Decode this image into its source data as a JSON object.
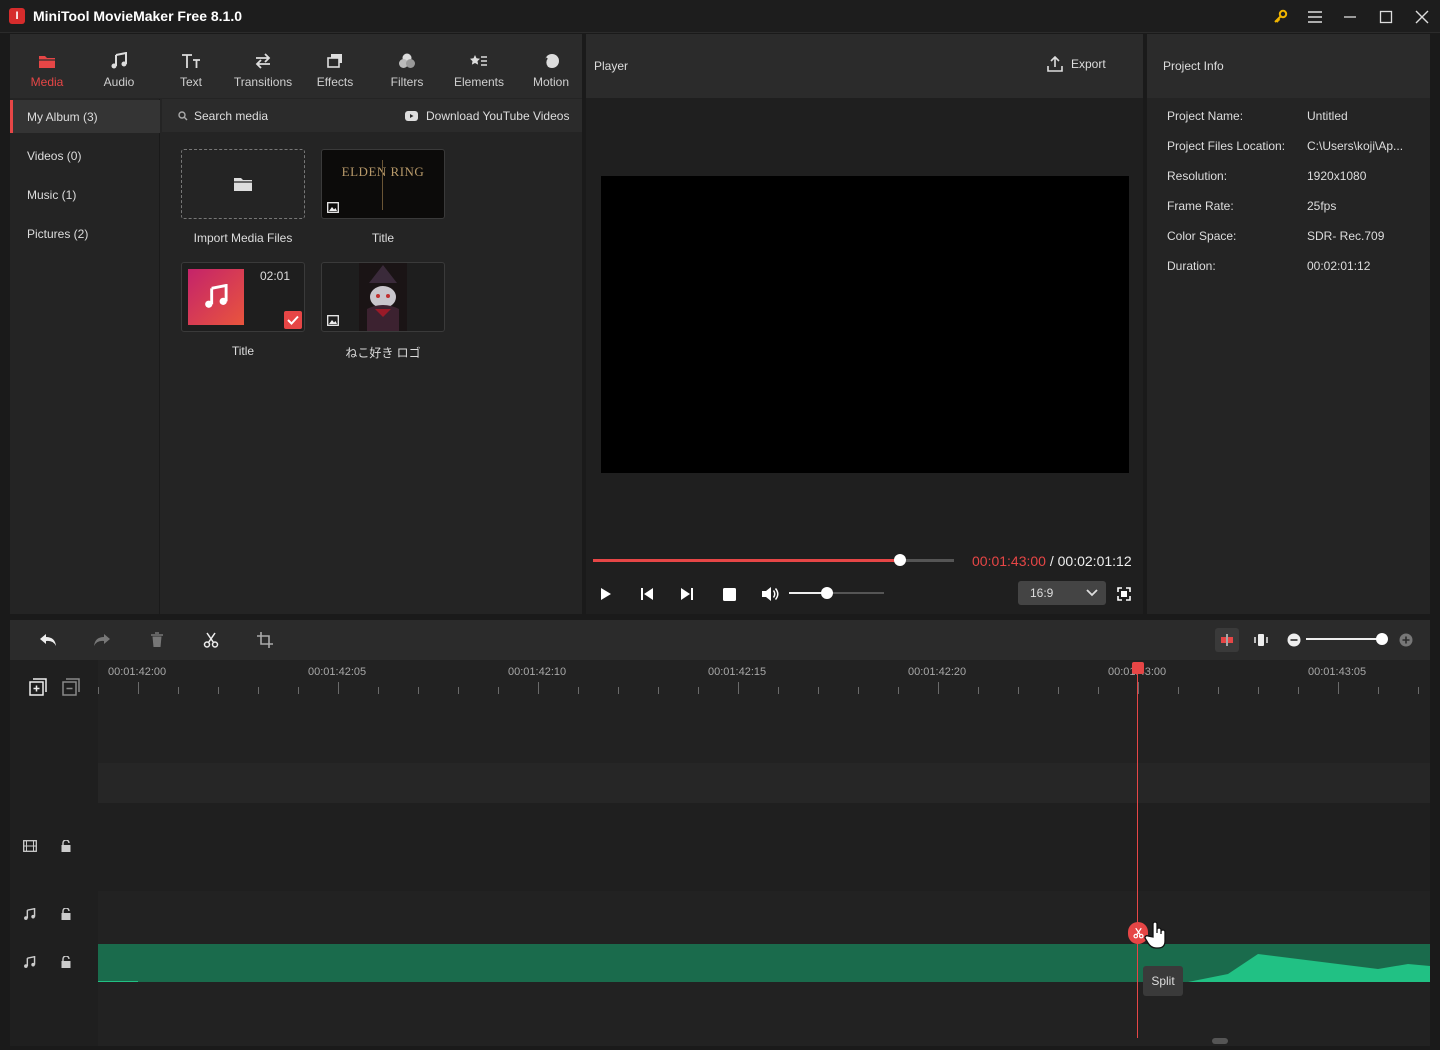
{
  "window": {
    "title": "MiniTool MovieMaker Free 8.1.0",
    "logo_letter": "I"
  },
  "toolbar": {
    "items": [
      {
        "label": "Media",
        "icon": "folder-icon",
        "active": true
      },
      {
        "label": "Audio",
        "icon": "music-note-icon"
      },
      {
        "label": "Text",
        "icon": "text-icon"
      },
      {
        "label": "Transitions",
        "icon": "swap-arrows-icon"
      },
      {
        "label": "Effects",
        "icon": "effects-icon"
      },
      {
        "label": "Filters",
        "icon": "filters-icon"
      },
      {
        "label": "Elements",
        "icon": "elements-icon"
      },
      {
        "label": "Motion",
        "icon": "motion-icon"
      }
    ]
  },
  "sidebar": {
    "items": [
      {
        "label": "My Album (3)",
        "active": true
      },
      {
        "label": "Videos (0)"
      },
      {
        "label": "Music (1)"
      },
      {
        "label": "Pictures (2)"
      }
    ]
  },
  "media": {
    "search_placeholder": "Search media",
    "download_label": "Download YouTube Videos",
    "items": [
      {
        "label": "Import Media Files",
        "kind": "import"
      },
      {
        "label": "Title",
        "kind": "image",
        "thumb_text": "ELDEN RING"
      },
      {
        "label": "Title",
        "kind": "audio",
        "duration": "02:01",
        "added": true
      },
      {
        "label": "ねこ好き ロゴ",
        "kind": "image"
      }
    ]
  },
  "player": {
    "title": "Player",
    "export_label": "Export",
    "current_time": "00:01:43:00",
    "separator": " / ",
    "total_time": "00:02:01:12",
    "progress": 0.85,
    "volume": 0.4,
    "aspect": "16:9"
  },
  "project_info": {
    "title": "Project Info",
    "rows": [
      {
        "key": "Project Name:",
        "value": "Untitled"
      },
      {
        "key": "Project Files Location:",
        "value": "C:\\Users\\koji\\Ap..."
      },
      {
        "key": "Resolution:",
        "value": "1920x1080"
      },
      {
        "key": "Frame Rate:",
        "value": "25fps"
      },
      {
        "key": "Color Space:",
        "value": "SDR- Rec.709"
      },
      {
        "key": "Duration:",
        "value": "00:02:01:12"
      }
    ]
  },
  "timeline": {
    "tick_labels": [
      "00:01:42:00",
      "00:01:42:05",
      "00:01:42:10",
      "00:01:42:15",
      "00:01:42:20",
      "00:01:43:00",
      "00:01:43:05"
    ],
    "zoom": 0.95,
    "tooltip": "Split"
  },
  "colors": {
    "accent": "#e64646",
    "audio_clip": "#1a6b4c",
    "audio_wave": "#21c184"
  }
}
